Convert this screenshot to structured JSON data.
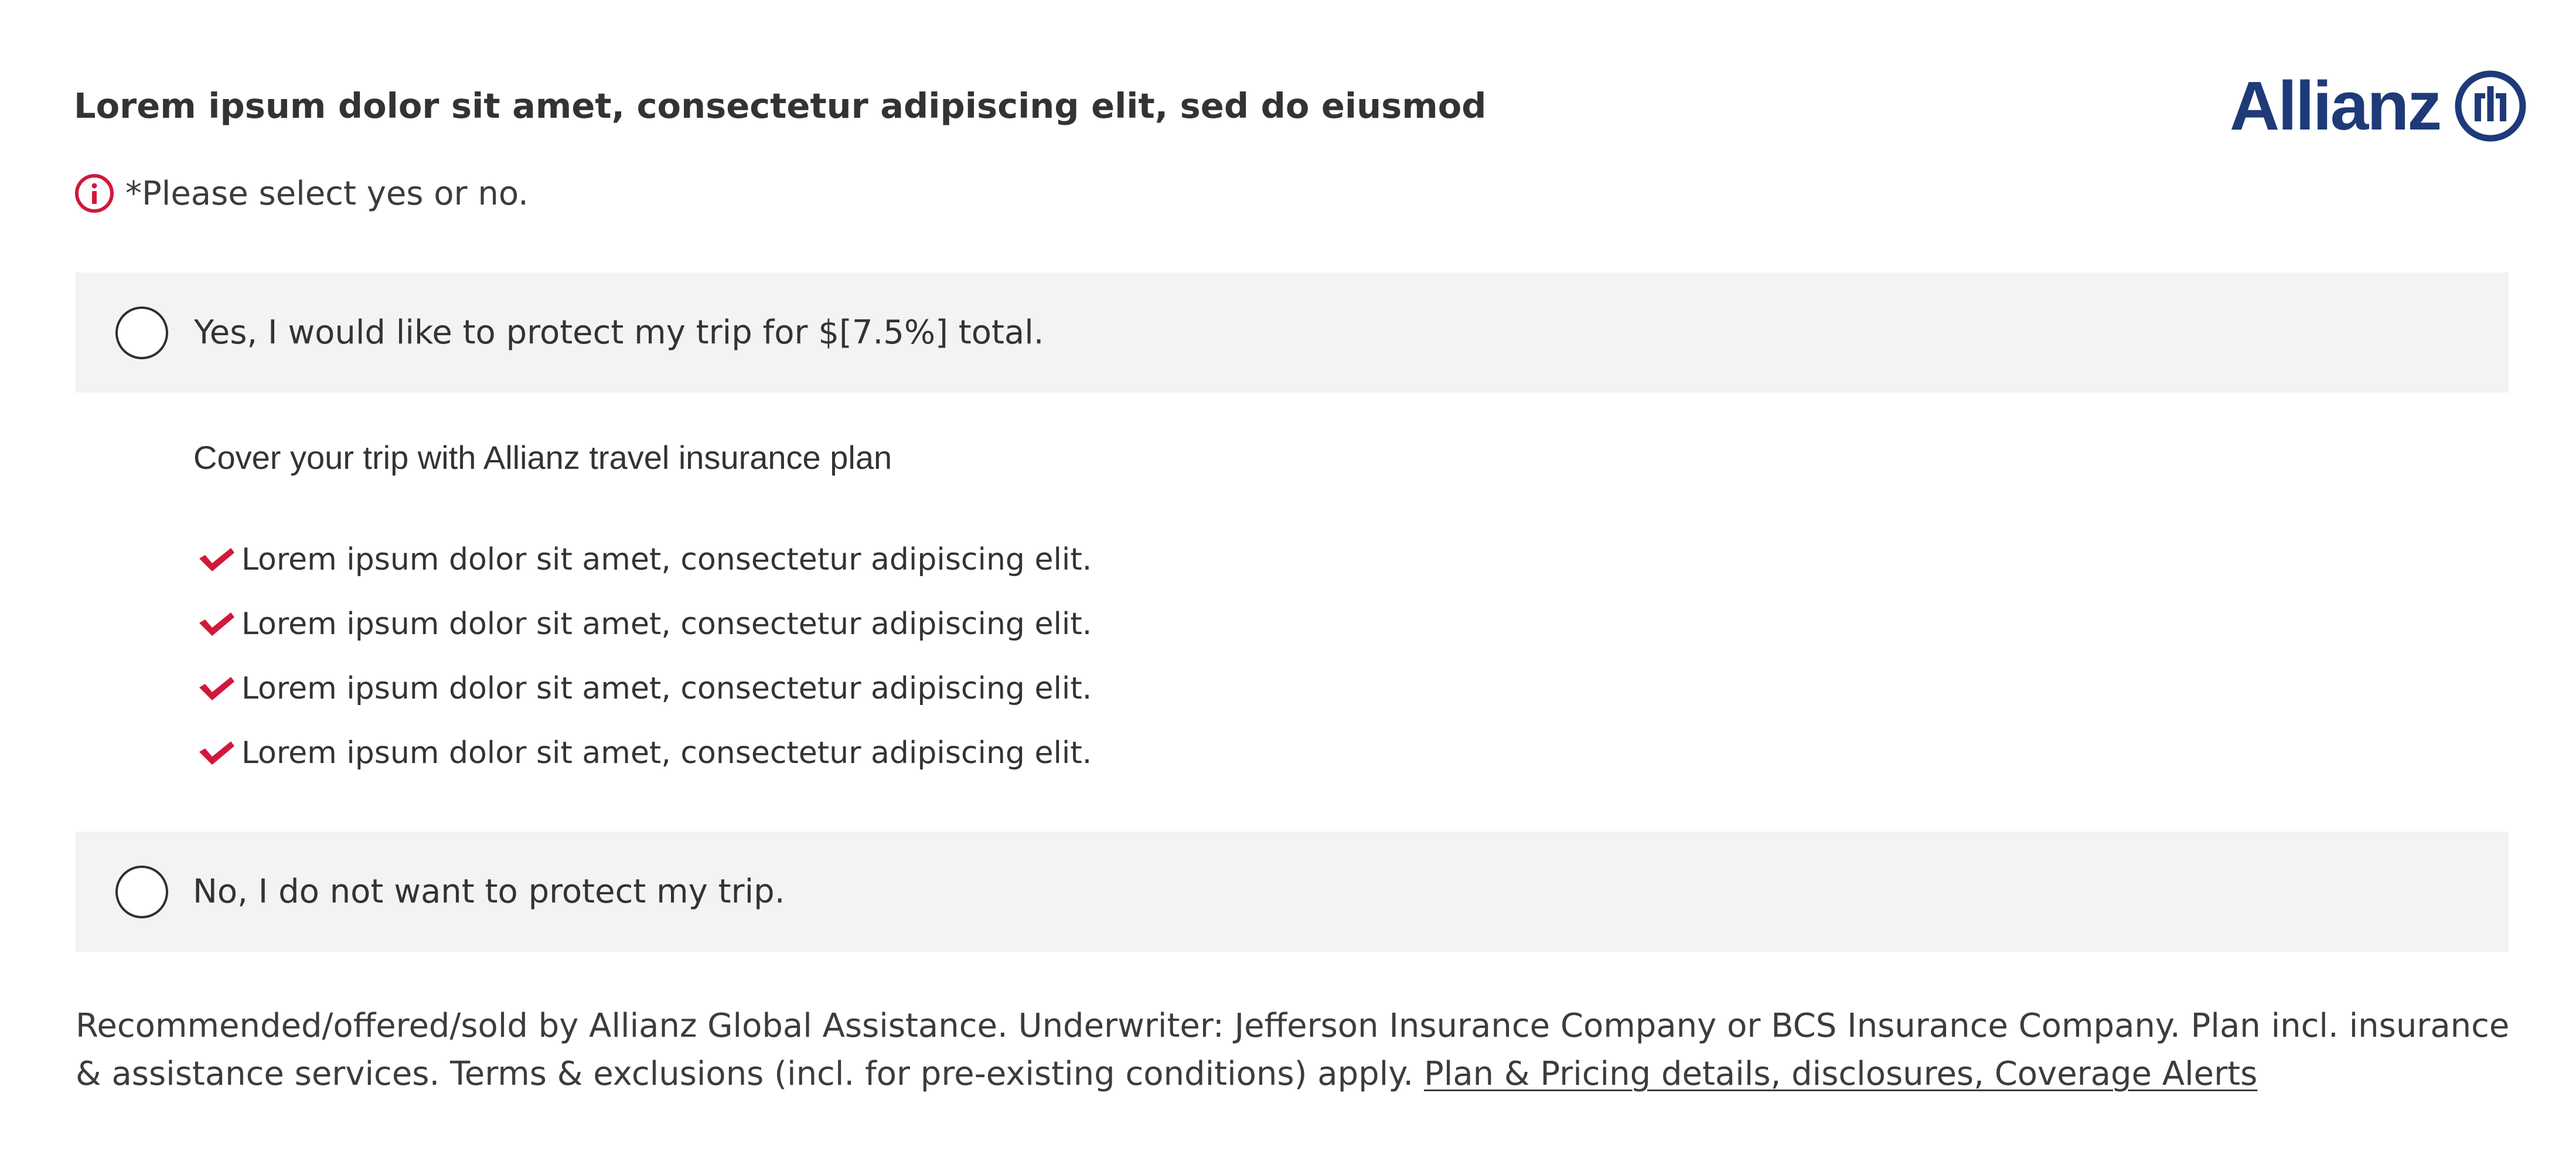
{
  "header": {
    "headline": "Lorem ipsum dolor sit amet, consectetur adipiscing elit, sed do eiusmod",
    "logo_text": "Allianz"
  },
  "notice": {
    "icon": "info-icon",
    "text": "*Please select yes or no."
  },
  "options": {
    "yes": {
      "label": "Yes, I would like to protect my trip for $[7.5%] total.",
      "selected": false
    },
    "no": {
      "label": "No, I do not want to protect my trip.",
      "selected": false
    }
  },
  "coverage": {
    "title": "Cover your trip with Allianz travel insurance plan",
    "benefits": [
      "Lorem ipsum dolor sit amet, consectetur adipiscing elit.",
      "Lorem ipsum dolor sit amet, consectetur adipiscing elit.",
      "Lorem ipsum dolor sit amet, consectetur adipiscing elit.",
      "Lorem ipsum dolor sit amet, consectetur adipiscing elit."
    ]
  },
  "disclaimer": {
    "text": "Recommended/offered/sold by Allianz Global Assistance. Underwriter: Jefferson Insurance Company or BCS Insurance Company. Plan incl. insurance & assistance services. Terms & exclusions (incl. for pre-existing conditions) apply. ",
    "link_text": "Plan & Pricing details, disclosures, Coverage Alerts"
  },
  "colors": {
    "brand_blue": "#1f3a78",
    "alert_red": "#d0193a",
    "option_background": "#f2f3f4",
    "text": "#333333"
  }
}
